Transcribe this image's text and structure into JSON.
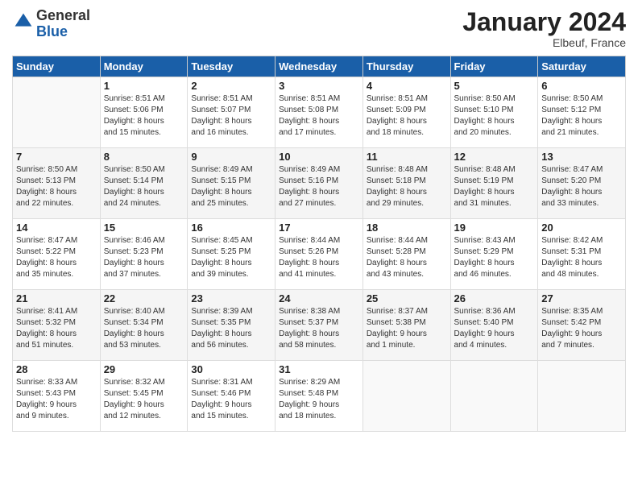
{
  "logo": {
    "general": "General",
    "blue": "Blue"
  },
  "title": "January 2024",
  "location": "Elbeuf, France",
  "days_of_week": [
    "Sunday",
    "Monday",
    "Tuesday",
    "Wednesday",
    "Thursday",
    "Friday",
    "Saturday"
  ],
  "weeks": [
    [
      {
        "day": "",
        "info": ""
      },
      {
        "day": "1",
        "info": "Sunrise: 8:51 AM\nSunset: 5:06 PM\nDaylight: 8 hours\nand 15 minutes."
      },
      {
        "day": "2",
        "info": "Sunrise: 8:51 AM\nSunset: 5:07 PM\nDaylight: 8 hours\nand 16 minutes."
      },
      {
        "day": "3",
        "info": "Sunrise: 8:51 AM\nSunset: 5:08 PM\nDaylight: 8 hours\nand 17 minutes."
      },
      {
        "day": "4",
        "info": "Sunrise: 8:51 AM\nSunset: 5:09 PM\nDaylight: 8 hours\nand 18 minutes."
      },
      {
        "day": "5",
        "info": "Sunrise: 8:50 AM\nSunset: 5:10 PM\nDaylight: 8 hours\nand 20 minutes."
      },
      {
        "day": "6",
        "info": "Sunrise: 8:50 AM\nSunset: 5:12 PM\nDaylight: 8 hours\nand 21 minutes."
      }
    ],
    [
      {
        "day": "7",
        "info": "Sunrise: 8:50 AM\nSunset: 5:13 PM\nDaylight: 8 hours\nand 22 minutes."
      },
      {
        "day": "8",
        "info": "Sunrise: 8:50 AM\nSunset: 5:14 PM\nDaylight: 8 hours\nand 24 minutes."
      },
      {
        "day": "9",
        "info": "Sunrise: 8:49 AM\nSunset: 5:15 PM\nDaylight: 8 hours\nand 25 minutes."
      },
      {
        "day": "10",
        "info": "Sunrise: 8:49 AM\nSunset: 5:16 PM\nDaylight: 8 hours\nand 27 minutes."
      },
      {
        "day": "11",
        "info": "Sunrise: 8:48 AM\nSunset: 5:18 PM\nDaylight: 8 hours\nand 29 minutes."
      },
      {
        "day": "12",
        "info": "Sunrise: 8:48 AM\nSunset: 5:19 PM\nDaylight: 8 hours\nand 31 minutes."
      },
      {
        "day": "13",
        "info": "Sunrise: 8:47 AM\nSunset: 5:20 PM\nDaylight: 8 hours\nand 33 minutes."
      }
    ],
    [
      {
        "day": "14",
        "info": "Sunrise: 8:47 AM\nSunset: 5:22 PM\nDaylight: 8 hours\nand 35 minutes."
      },
      {
        "day": "15",
        "info": "Sunrise: 8:46 AM\nSunset: 5:23 PM\nDaylight: 8 hours\nand 37 minutes."
      },
      {
        "day": "16",
        "info": "Sunrise: 8:45 AM\nSunset: 5:25 PM\nDaylight: 8 hours\nand 39 minutes."
      },
      {
        "day": "17",
        "info": "Sunrise: 8:44 AM\nSunset: 5:26 PM\nDaylight: 8 hours\nand 41 minutes."
      },
      {
        "day": "18",
        "info": "Sunrise: 8:44 AM\nSunset: 5:28 PM\nDaylight: 8 hours\nand 43 minutes."
      },
      {
        "day": "19",
        "info": "Sunrise: 8:43 AM\nSunset: 5:29 PM\nDaylight: 8 hours\nand 46 minutes."
      },
      {
        "day": "20",
        "info": "Sunrise: 8:42 AM\nSunset: 5:31 PM\nDaylight: 8 hours\nand 48 minutes."
      }
    ],
    [
      {
        "day": "21",
        "info": "Sunrise: 8:41 AM\nSunset: 5:32 PM\nDaylight: 8 hours\nand 51 minutes."
      },
      {
        "day": "22",
        "info": "Sunrise: 8:40 AM\nSunset: 5:34 PM\nDaylight: 8 hours\nand 53 minutes."
      },
      {
        "day": "23",
        "info": "Sunrise: 8:39 AM\nSunset: 5:35 PM\nDaylight: 8 hours\nand 56 minutes."
      },
      {
        "day": "24",
        "info": "Sunrise: 8:38 AM\nSunset: 5:37 PM\nDaylight: 8 hours\nand 58 minutes."
      },
      {
        "day": "25",
        "info": "Sunrise: 8:37 AM\nSunset: 5:38 PM\nDaylight: 9 hours\nand 1 minute."
      },
      {
        "day": "26",
        "info": "Sunrise: 8:36 AM\nSunset: 5:40 PM\nDaylight: 9 hours\nand 4 minutes."
      },
      {
        "day": "27",
        "info": "Sunrise: 8:35 AM\nSunset: 5:42 PM\nDaylight: 9 hours\nand 7 minutes."
      }
    ],
    [
      {
        "day": "28",
        "info": "Sunrise: 8:33 AM\nSunset: 5:43 PM\nDaylight: 9 hours\nand 9 minutes."
      },
      {
        "day": "29",
        "info": "Sunrise: 8:32 AM\nSunset: 5:45 PM\nDaylight: 9 hours\nand 12 minutes."
      },
      {
        "day": "30",
        "info": "Sunrise: 8:31 AM\nSunset: 5:46 PM\nDaylight: 9 hours\nand 15 minutes."
      },
      {
        "day": "31",
        "info": "Sunrise: 8:29 AM\nSunset: 5:48 PM\nDaylight: 9 hours\nand 18 minutes."
      },
      {
        "day": "",
        "info": ""
      },
      {
        "day": "",
        "info": ""
      },
      {
        "day": "",
        "info": ""
      }
    ]
  ]
}
